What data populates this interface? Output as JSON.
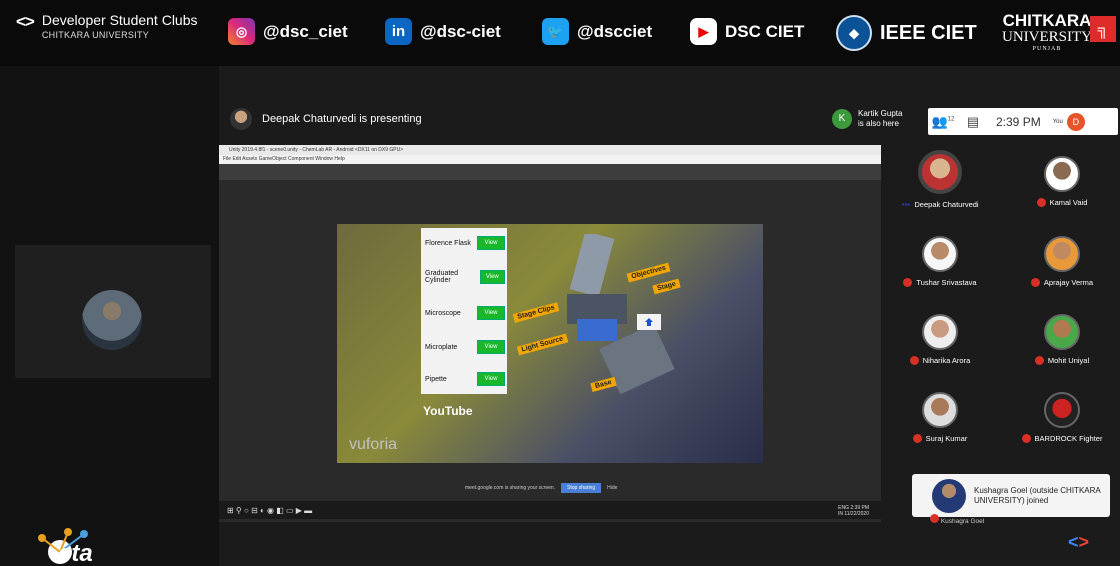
{
  "banner": {
    "dsc_mark": "<>",
    "dsc_title": "Developer Student Clubs",
    "dsc_subtitle": "CHITKARA UNIVERSITY",
    "instagram": "@dsc_ciet",
    "linkedin": "@dsc-ciet",
    "twitter": "@dscciet",
    "youtube": "DSC CIET",
    "ieee": "IEEE CIET",
    "chitkara_line1": "CHITKARA",
    "chitkara_line2": "UNIVERSITY",
    "chitkara_line3": "PUNJAB",
    "instagram_glyph": "◎",
    "linkedin_glyph": "in",
    "twitter_glyph": "🐦",
    "youtube_glyph": "▶",
    "ieee_glyph": "⬥",
    "chitkara_glyph": "╗"
  },
  "presenter": {
    "text": "Deepak Chaturvedi is presenting"
  },
  "also_here": {
    "initial": "K",
    "name": "Kartik Gupta",
    "note": "is also here"
  },
  "toolbar": {
    "people_icon": "👥",
    "people_count": "12",
    "chat_icon": "▤",
    "time": "2:39 PM",
    "you_label": "You",
    "you_initial": "D"
  },
  "screen": {
    "window_title": "Unity 2019.4.8f1 - scene0.unity - ChemLab AR - Android <DX11 on DX9 GPU>",
    "menu": "File   Edit   Assets   GameObject   Component   Window   Help",
    "lab_items": [
      {
        "name": "Florence Flask",
        "btn": "View"
      },
      {
        "name": "Graduated Cylinder",
        "btn": "View"
      },
      {
        "name": "Microscope",
        "btn": "View"
      },
      {
        "name": "Microplate",
        "btn": "View"
      },
      {
        "name": "Pipette",
        "btn": "View"
      }
    ],
    "tags": {
      "objectives": "Objectives",
      "stage": "Stage",
      "stage_clips": "Stage Clips",
      "light_source": "Light Source",
      "base": "Base"
    },
    "vuforia": "vuforia",
    "youtube": "YouTube",
    "share_note": "meet.google.com is sharing your screen.",
    "stop_sharing": "Stop sharing",
    "hide": "Hide",
    "taskbar_icons": "⊞  ⚲  ○  ⊟  ◐  ◉  ◧  ▭  ▶  ▬",
    "tray": "ENG 2:39 PM",
    "tray_date": "IN 11/22/2020"
  },
  "participants": [
    {
      "name": "Deepak Chaturvedi",
      "mic": "on"
    },
    {
      "name": "Kamal Vaid",
      "mic": "off"
    },
    {
      "name": "Tushar Srivastava",
      "mic": "off"
    },
    {
      "name": "Aprajay Verma",
      "mic": "off"
    },
    {
      "name": "Niharika Arora",
      "mic": "off"
    },
    {
      "name": "Mohit Uniyal",
      "mic": "off"
    },
    {
      "name": "Suraj Kumar",
      "mic": "off"
    },
    {
      "name": "BARDROCK Fighter",
      "mic": "off"
    }
  ],
  "toast": {
    "text": "Kushagra Goel (outside CHITKARA UNIVERSITY) joined"
  },
  "kushagra_tile": {
    "name": "Kushagra Goel"
  },
  "bottom": {
    "cta_text": "cta",
    "gdsc_corner": "<>"
  },
  "colors": {
    "mic_off": "#d93025",
    "view_button": "#18b82a",
    "ar_tag": "#f0a500",
    "stop_sharing": "#4a7fd8"
  }
}
